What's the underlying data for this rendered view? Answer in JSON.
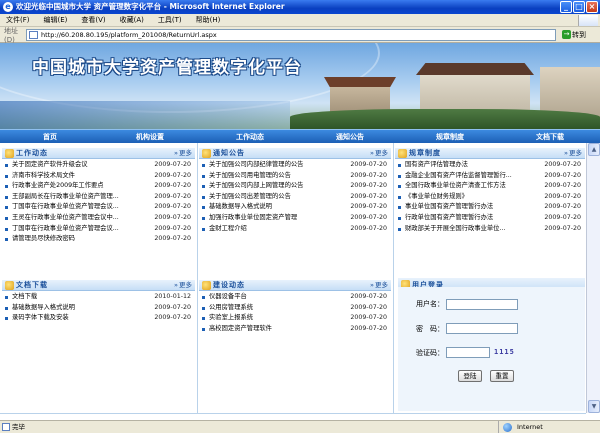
{
  "window": {
    "title": "欢迎光临中国城市大学 资产管理数字化平台 - Microsoft Internet Explorer"
  },
  "menu": [
    "文件(F)",
    "编辑(E)",
    "查看(V)",
    "收藏(A)",
    "工具(T)",
    "帮助(H)"
  ],
  "address": {
    "label": "地址(D)",
    "url": "http://60.208.80.195/platform_201008/ReturnUrl.aspx",
    "go_label": "转到"
  },
  "banner": {
    "title": "中国城市大学资产管理数字化平台"
  },
  "nav": [
    "首页",
    "机构设置",
    "工作动态",
    "通知公告",
    "规章制度",
    "文档下载"
  ],
  "sections": {
    "work": {
      "title": "工作动态",
      "more": "更多",
      "items": [
        {
          "title": "关于固定资产软件升级会议",
          "date": "2009-07-20"
        },
        {
          "title": "济南市科学技术局文件",
          "date": "2009-07-20"
        },
        {
          "title": "行政事业资产处2009年工作要点",
          "date": "2009-07-20"
        },
        {
          "title": "王部副局长在行政事业单位资产管理...",
          "date": "2009-07-20"
        },
        {
          "title": "丁国审在行政事业单位资产管理会议...",
          "date": "2009-07-20"
        },
        {
          "title": "王灵在行政事业单位资产管理会议中...",
          "date": "2009-07-20"
        },
        {
          "title": "丁国审在行政事业单位资产管理会议...",
          "date": "2009-07-20"
        },
        {
          "title": "请管理员尽快修改密码",
          "date": "2009-07-20"
        }
      ]
    },
    "notice": {
      "title": "通知公告",
      "more": "更多",
      "items": [
        {
          "title": "关于加强公司内部纪律管理的公告",
          "date": "2009-07-20"
        },
        {
          "title": "关于加强公司用电管理的公告",
          "date": "2009-07-20"
        },
        {
          "title": "关于加强公司内部上网管理的公告",
          "date": "2009-07-20"
        },
        {
          "title": "关于加强公司出差管理的公告",
          "date": "2009-07-20"
        },
        {
          "title": "基础数据导入格式说明",
          "date": "2009-07-20"
        },
        {
          "title": "加强行政事业单位固定资产管理",
          "date": "2009-07-20"
        },
        {
          "title": "金财工程介绍",
          "date": "2009-07-20"
        }
      ]
    },
    "rules": {
      "title": "规章制度",
      "more": "更多",
      "items": [
        {
          "title": "国有资产评估管理办法",
          "date": "2009-07-20"
        },
        {
          "title": "金融企业国有资产评估监督管理暂行...",
          "date": "2009-07-20"
        },
        {
          "title": "全国行政事业单位资产清查工作方法",
          "date": "2009-07-20"
        },
        {
          "title": "《事业单位财务规则》",
          "date": "2009-07-20"
        },
        {
          "title": "事业单位国有资产管理暂行办法",
          "date": "2009-07-20"
        },
        {
          "title": "行政单位国有资产管理暂行办法",
          "date": "2009-07-20"
        },
        {
          "title": "财政部关于开展全国行政事业单位...",
          "date": "2009-07-20"
        }
      ]
    },
    "docs": {
      "title": "文档下载",
      "more": "更多",
      "items": [
        {
          "title": "文档下载",
          "date": "2010-01-12"
        },
        {
          "title": "基础数据导入格式说明",
          "date": "2009-07-20"
        },
        {
          "title": "录码字体下载及安装",
          "date": "2009-07-20"
        }
      ]
    },
    "build": {
      "title": "建设动态",
      "more": "更多",
      "items": [
        {
          "title": "仪器设备平台",
          "date": "2009-07-20"
        },
        {
          "title": "公用房管理系统",
          "date": "2009-07-20"
        },
        {
          "title": "实验室上报系统",
          "date": "2009-07-20"
        },
        {
          "title": "高校固定资产管理软件",
          "date": "2009-07-20"
        }
      ]
    }
  },
  "login": {
    "title": "用户登录",
    "username_label": "用户名：",
    "password_label": "密　码：",
    "captcha_label": "验证码：",
    "captcha_value": "1115",
    "submit_label": "登陆",
    "reset_label": "重置"
  },
  "status": {
    "text": "完毕",
    "zone": "Internet"
  }
}
